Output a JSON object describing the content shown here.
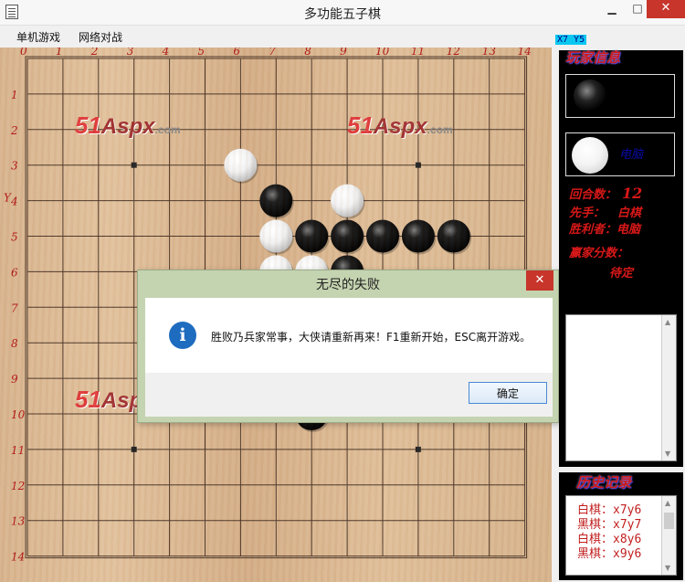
{
  "window": {
    "title": "多功能五子棋",
    "minimize": "▁",
    "maximize": "□",
    "close": "✕"
  },
  "menu": {
    "items": [
      "单机游戏",
      "网络对战"
    ]
  },
  "status": {
    "coord_label": "X7 Y5"
  },
  "board": {
    "size": 15,
    "col_labels": [
      "0",
      "1",
      "2",
      "3",
      "4",
      "5",
      "6",
      "7",
      "8",
      "9",
      "10",
      "11",
      "12",
      "13",
      "14"
    ],
    "row_labels": [
      "1",
      "2",
      "3",
      "4",
      "5",
      "6",
      "7",
      "8",
      "9",
      "10",
      "11",
      "12",
      "13",
      "14"
    ],
    "extra_label": "Y",
    "star_points": [
      [
        3,
        3
      ],
      [
        11,
        3
      ],
      [
        3,
        11
      ],
      [
        11,
        11
      ]
    ],
    "stones": [
      {
        "color": "white",
        "col": 6,
        "row": 3
      },
      {
        "color": "black",
        "col": 7,
        "row": 4
      },
      {
        "color": "white",
        "col": 9,
        "row": 4
      },
      {
        "color": "white",
        "col": 7,
        "row": 5
      },
      {
        "color": "black",
        "col": 8,
        "row": 5
      },
      {
        "color": "black",
        "col": 9,
        "row": 5
      },
      {
        "color": "black",
        "col": 10,
        "row": 5
      },
      {
        "color": "black",
        "col": 11,
        "row": 5
      },
      {
        "color": "black",
        "col": 12,
        "row": 5
      },
      {
        "color": "white",
        "col": 7,
        "row": 6
      },
      {
        "color": "white",
        "col": 8,
        "row": 6
      },
      {
        "color": "black",
        "col": 9,
        "row": 6
      },
      {
        "color": "black",
        "col": 8,
        "row": 10
      }
    ],
    "colors": {
      "line": "#4a3426",
      "label": "#b01414"
    }
  },
  "watermark": {
    "num": "51",
    "name": "Aspx",
    "domain": ".com"
  },
  "side": {
    "player_title": "玩家信息",
    "player2_name": "电脑",
    "round_label": "回合数：",
    "round_value": "12",
    "first_label": "先手：",
    "first_value": "白棋",
    "winner_label": "胜利者：",
    "winner_value": "电脑",
    "score_label": "赢家分数：",
    "score_value": "待定",
    "history_title": "历史记录",
    "history": [
      "白棋：x7y6",
      "黑棋：x7y7",
      "白棋：x8y6",
      "黑棋：x9y6"
    ]
  },
  "dialog": {
    "title": "无尽的失败",
    "close": "✕",
    "icon": "i",
    "message": "胜败乃兵家常事，大侠请重新再来！F1重新开始，ESC离开游戏。",
    "ok_label": "确定"
  }
}
